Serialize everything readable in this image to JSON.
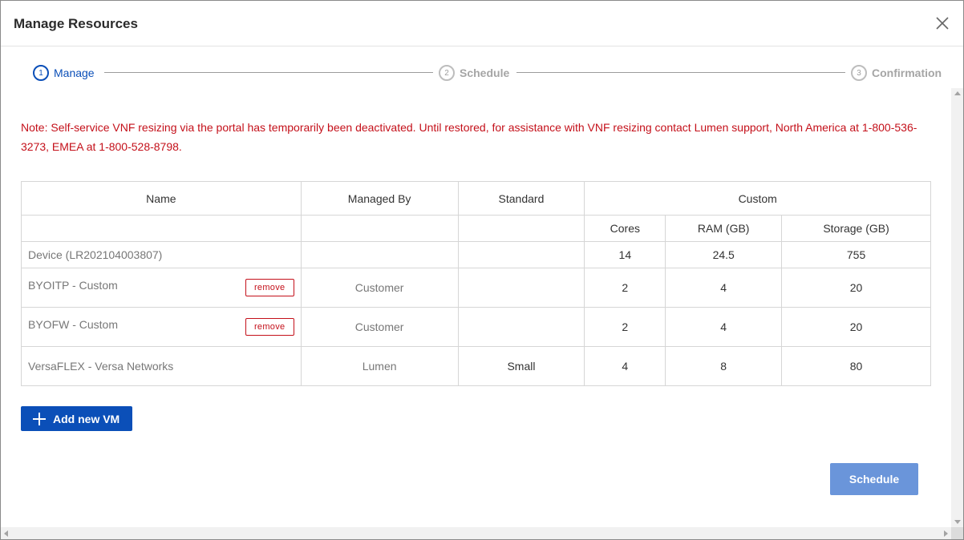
{
  "dialog": {
    "title": "Manage Resources"
  },
  "stepper": {
    "steps": [
      {
        "num": "1",
        "label": "Manage",
        "active": true
      },
      {
        "num": "2",
        "label": "Schedule",
        "active": false
      },
      {
        "num": "3",
        "label": "Confirmation",
        "active": false
      }
    ]
  },
  "note": "Note: Self-service VNF resizing via the portal has temporarily been deactivated. Until restored, for assistance with VNF resizing contact Lumen support, North America at 1-800-536-3273, EMEA at 1-800-528-8798.",
  "table": {
    "headers": {
      "name": "Name",
      "managed_by": "Managed By",
      "standard": "Standard",
      "custom": "Custom",
      "cores": "Cores",
      "ram": "RAM (GB)",
      "storage": "Storage (GB)"
    },
    "device": {
      "name": "Device (LR202104003807)",
      "cores": "14",
      "ram": "24.5",
      "storage": "755"
    },
    "rows": [
      {
        "name": "BYOITP - Custom",
        "managed_by": "Customer",
        "standard": "",
        "cores": "2",
        "ram": "4",
        "storage": "20",
        "remove": "remove"
      },
      {
        "name": "BYOFW - Custom",
        "managed_by": "Customer",
        "standard": "",
        "cores": "2",
        "ram": "4",
        "storage": "20",
        "remove": "remove"
      },
      {
        "name": "VersaFLEX - Versa Networks",
        "managed_by": "Lumen",
        "standard": "Small",
        "cores": "4",
        "ram": "8",
        "storage": "80"
      }
    ]
  },
  "buttons": {
    "add_vm": "Add new VM",
    "schedule": "Schedule"
  },
  "colors": {
    "primary": "#0b4fb8",
    "primary_disabled": "#6a95da",
    "note_red": "#c4101a"
  }
}
